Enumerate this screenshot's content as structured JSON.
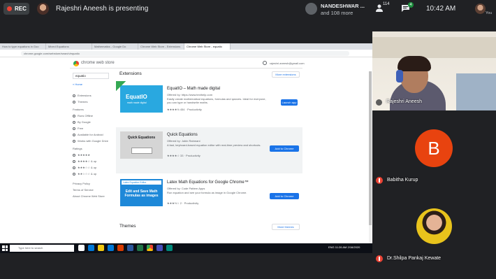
{
  "meeting": {
    "rec_label": "REC",
    "presenter_text": "Rajeshri Aneesh is presenting",
    "participant_name": "NANDESHWAR ...",
    "participant_more": "and 108 more",
    "people_count": "114",
    "chat_badge": "4",
    "clock": "10:42 AM",
    "self_label": "You"
  },
  "tiles": {
    "presenter_name": "Rajeshri Aneesh",
    "tile2_initial": "B",
    "tile2_name": "Babitha Kurup",
    "tile3_name": "Dr.Shilpa Pankaj Kewate"
  },
  "browser": {
    "tabs": [
      "How to type equations in Goo",
      "Mixed Equations",
      "Mathematics - Google Do",
      "Chrome Web Store - Extensions",
      "Chrome Web Store - equatio"
    ],
    "address": "chrome.google.com/webstore/search/equatio",
    "status_url": "https://chrome.google.com/webstore/detail/quick-equations/..."
  },
  "store": {
    "title": "chrome web store",
    "user": "rajeshri.aneesh@gmail.com",
    "search_value": "equatio",
    "home_link": "« Home",
    "filters": [
      "Extensions",
      "Themes",
      "Features",
      "Runs Offline",
      "By Google",
      "Free",
      "Available for Android",
      "Works with Google Drive",
      "Ratings"
    ],
    "ratings": [
      "★★★★★",
      "★★★★☆ & up",
      "★★★☆☆ & up",
      "★★☆☆☆ & up"
    ],
    "footer_links": [
      "Privacy Policy",
      "Terms of Service",
      "About Chrome Web Store"
    ],
    "section_extensions": "Extensions",
    "more_extensions": "More extensions",
    "section_themes": "Themes",
    "more_themes": "More themes"
  },
  "extensions": [
    {
      "name": "EquatIO – Math made digital",
      "by": "Offered by: https://www.texthelp.com",
      "desc": "Easily create mathematical equations, formulas and quizzes. Ideal for everyone, you can type or handwrite maths.",
      "rating": "★★★★½ 454 · Productivity",
      "button": "Launch app",
      "thumb_title": "EquatIO",
      "thumb_sub": "math made digital"
    },
    {
      "name": "Quick Equations",
      "by": "Offered by: Jubin Rahmani",
      "desc": "A fast, keyboard-based equation editor with real-time preview and shortcuts.",
      "rating": "★★★★☆ 33 · Productivity",
      "button": "Add to Chrome",
      "thumb_title": "Quick Equations"
    },
    {
      "name": "Latex Math Equations for Google Chrome™",
      "by": "Offered by: Code Pattern Apps",
      "desc": "Run equation and see your formula as image in Google Chrome.",
      "rating": "★★★½☆ 2 · Productivity",
      "button": "Add to Chrome",
      "thumb_bar": "Latex Equation Editor",
      "thumb_title": "Edit and Save Math Formulas as images"
    }
  ],
  "taskbar": {
    "search_placeholder": "Type here to search",
    "tray": "ENG 11:26 AM 2/16/2020"
  },
  "colors": {
    "meet_bg": "#202124",
    "rec_red": "#ea4335",
    "chrome_blue": "#1a73e8",
    "avatar_orange": "#e8430f"
  }
}
